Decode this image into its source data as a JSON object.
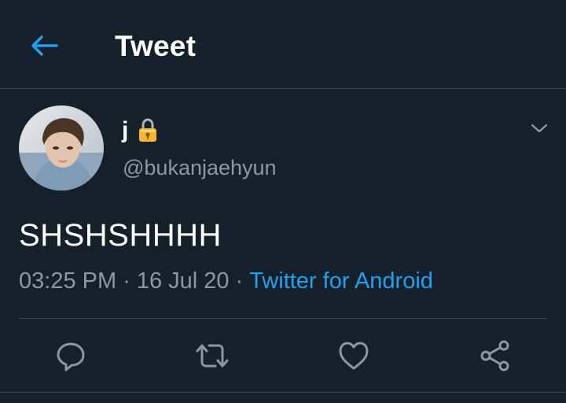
{
  "header": {
    "back_icon": "arrow-left-icon",
    "title": "Tweet"
  },
  "tweet": {
    "author": {
      "display_name": "j",
      "lock_icon": "lock-icon",
      "handle": "@bukanjaehyun",
      "avatar": "avatar-photo"
    },
    "menu_icon": "chevron-down-icon",
    "text": "SHSHSHHHH",
    "time": "03:25 PM",
    "separator": "·",
    "date": "16 Jul 20",
    "source": "Twitter for Android"
  },
  "actions": [
    {
      "name": "reply",
      "icon": "reply-icon"
    },
    {
      "name": "retweet",
      "icon": "retweet-icon"
    },
    {
      "name": "like",
      "icon": "heart-icon"
    },
    {
      "name": "share",
      "icon": "share-icon"
    }
  ],
  "colors": {
    "background": "#15202b",
    "accent": "#1da1f2",
    "secondary_text": "#8899a6",
    "divider": "#38444d"
  }
}
